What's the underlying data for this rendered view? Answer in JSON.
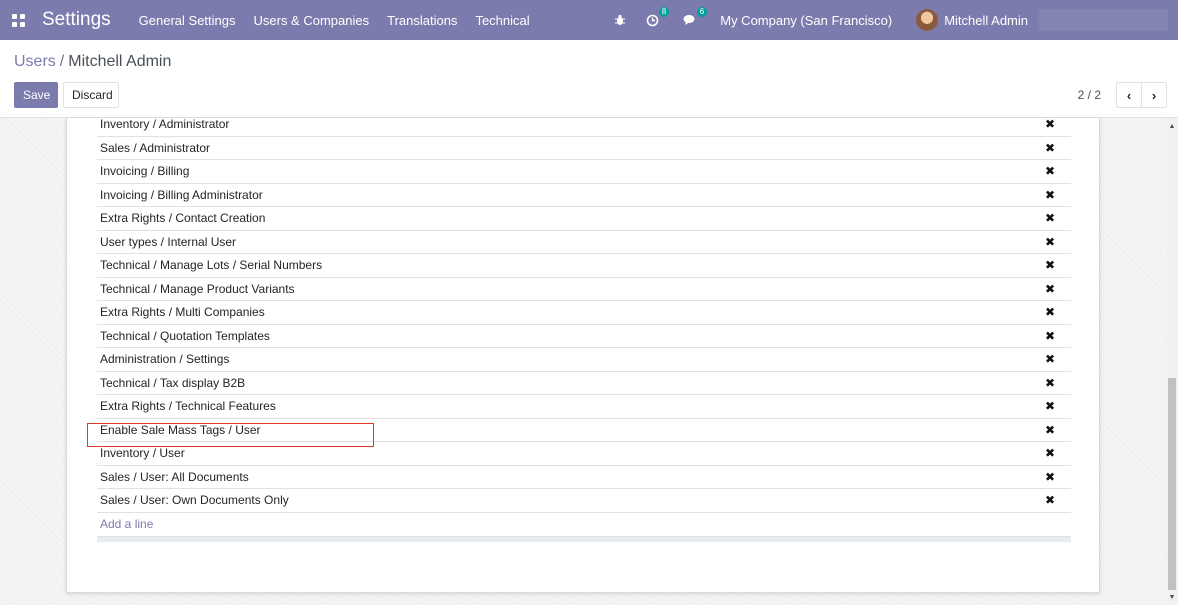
{
  "navbar": {
    "brand": "Settings",
    "menu": [
      "General Settings",
      "Users & Companies",
      "Translations",
      "Technical"
    ],
    "activity_count": "8",
    "messages_count": "6",
    "company": "My Company (San Francisco)",
    "user_name": "Mitchell Admin"
  },
  "breadcrumb": {
    "parent": "Users",
    "separator": "/",
    "current": "Mitchell Admin"
  },
  "buttons": {
    "save": "Save",
    "discard": "Discard"
  },
  "pager": {
    "value": "2 / 2",
    "prev": "‹",
    "next": "›"
  },
  "groups": [
    "Inventory / Administrator",
    "Sales / Administrator",
    "Invoicing / Billing",
    "Invoicing / Billing Administrator",
    "Extra Rights / Contact Creation",
    "User types / Internal User",
    "Technical / Manage Lots / Serial Numbers",
    "Technical / Manage Product Variants",
    "Extra Rights / Multi Companies",
    "Technical / Quotation Templates",
    "Administration / Settings",
    "Technical / Tax display B2B",
    "Extra Rights / Technical Features",
    "Enable Sale Mass Tags / User",
    "Inventory / User",
    "Sales / User: All Documents",
    "Sales / User: Own Documents Only"
  ],
  "add_line": "Add a line",
  "delete_glyph": "✖",
  "colors": {
    "navbar": "#7c7bad",
    "primary": "#7c7bad",
    "highlight": "#e0362d"
  }
}
